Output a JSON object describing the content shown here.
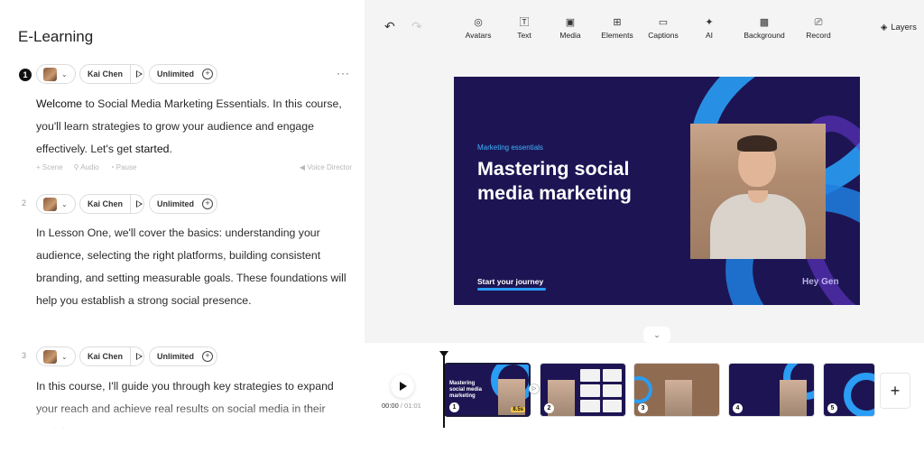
{
  "left": {
    "title": "E-Learning",
    "scenes": [
      {
        "number": "1",
        "voice": "Kai Chen",
        "speed": "Unlimited",
        "more": "···",
        "text_parts": [
          "Welcome",
          " to Social Media Marketing Essentials. In this course, you'll learn strategies to grow your audience and engage effectively. Let's get ",
          "started",
          "."
        ],
        "tools": {
          "scene": "+ Scene",
          "audio": "Audio",
          "pause": "Pause",
          "voice_director": "Voice Director"
        }
      },
      {
        "number": "2",
        "voice": "Kai Chen",
        "speed": "Unlimited",
        "text": "In Lesson One, we'll cover the basics: understanding your audience, selecting the right platforms, building consistent branding, and setting measurable goals. These foundations will help you establish a strong social presence."
      },
      {
        "number": "3",
        "voice": "Kai Chen",
        "speed": "Unlimited",
        "text": "In this course, I'll guide you through key strategies to expand your reach and achieve real results on social media in their social..."
      }
    ]
  },
  "toolbar": {
    "undo": "↶",
    "redo": "↷",
    "tools": [
      {
        "id": "avatars",
        "icon": "avatar-icon",
        "label": "Avatars"
      },
      {
        "id": "text",
        "icon": "text-icon",
        "label": "Text"
      },
      {
        "id": "media",
        "icon": "media-icon",
        "label": "Media"
      },
      {
        "id": "elements",
        "icon": "elements-icon",
        "label": "Elements"
      },
      {
        "id": "captions",
        "icon": "captions-icon",
        "label": "Captions"
      },
      {
        "id": "ai",
        "icon": "ai-sparkle-icon",
        "label": "AI"
      },
      {
        "id": "background",
        "icon": "background-icon",
        "label": "Background"
      },
      {
        "id": "record",
        "icon": "record-icon",
        "label": "Record"
      }
    ],
    "layers_label": "Layers"
  },
  "slide": {
    "kicker": "Marketing essentials",
    "title": "Mastering social media marketing",
    "cta": "Start your journey",
    "brand": "Hey Gen",
    "colors": {
      "background": "#1d1553",
      "accent": "#2a9df4",
      "kicker": "#3fb3ff"
    }
  },
  "timeline": {
    "current_time": "00:00",
    "total_time": "/ 01:01",
    "thumbnails": [
      {
        "number": "1",
        "title": "Mastering social media marketing",
        "duration": "8.5s",
        "selected": true
      },
      {
        "number": "2"
      },
      {
        "number": "3"
      },
      {
        "number": "4"
      },
      {
        "number": "5"
      }
    ],
    "add_label": "+"
  }
}
